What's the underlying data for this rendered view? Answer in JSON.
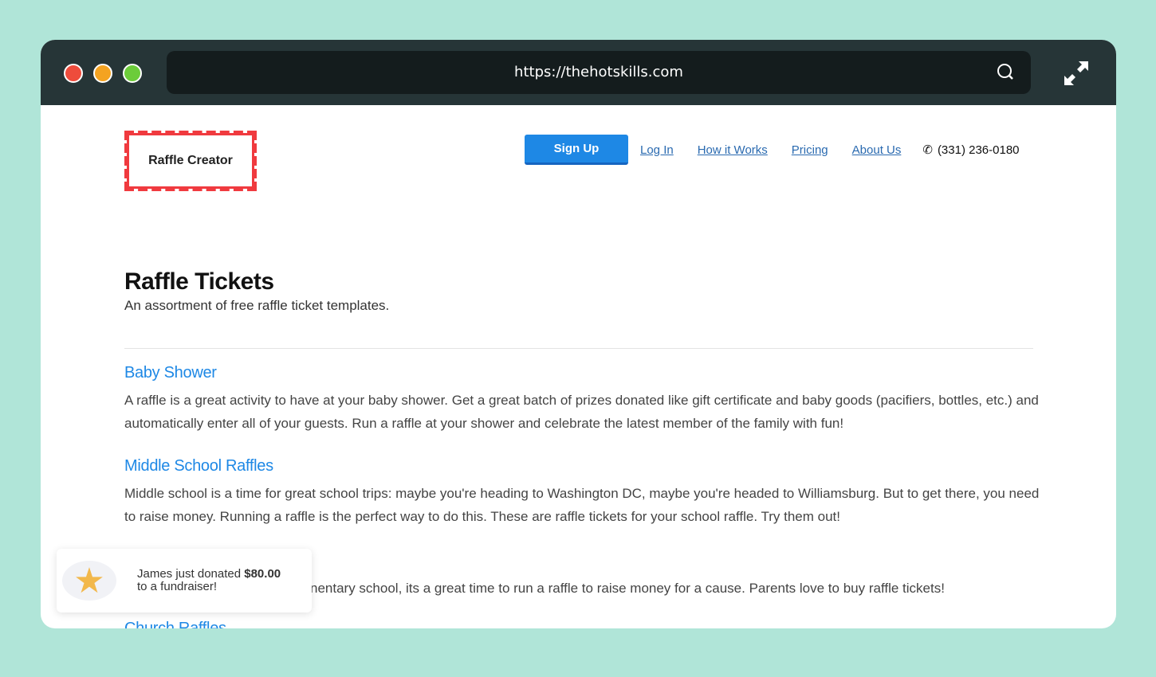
{
  "browser": {
    "url": "https://thehotskills.com",
    "colors": {
      "close": "#ee4c3c",
      "minimize": "#f4a321",
      "maximize": "#6ccc3a"
    }
  },
  "header": {
    "logo": "Raffle Creator",
    "signup": "Sign Up",
    "links": [
      "Log In",
      "How it Works",
      "Pricing",
      "About Us"
    ],
    "phone": "(331) 236-0180"
  },
  "main": {
    "title": "Raffle Tickets",
    "subtitle": "An assortment of free raffle ticket templates.",
    "sections": [
      {
        "title": "Baby Shower",
        "text": "A raffle is a great activity to have at your baby shower. Get a great batch of prizes donated like gift certificate and baby goods (pacifiers, bottles, etc.) and automatically enter all of your guests. Run a raffle at your shower and celebrate the latest member of the family with fun!"
      },
      {
        "title": "Middle School Raffles",
        "text": "Middle school is a time for great school trips: maybe you're heading to Washington DC, maybe you're headed to Williamsburg. But to get there, you need to raise money. Running a raffle is the perfect way to do this. These are raffle tickets for your school raffle. Try them out!"
      },
      {
        "title": "",
        "text": "nentary school, its a great time to run a raffle to raise money for a cause. Parents love to buy raffle tickets!"
      },
      {
        "title": "Church Raffles",
        "text": ""
      }
    ]
  },
  "toast": {
    "text": "James just donated",
    "amount": "$80.00",
    "text2": "to a fundraiser!",
    "icon": "star-icon"
  }
}
